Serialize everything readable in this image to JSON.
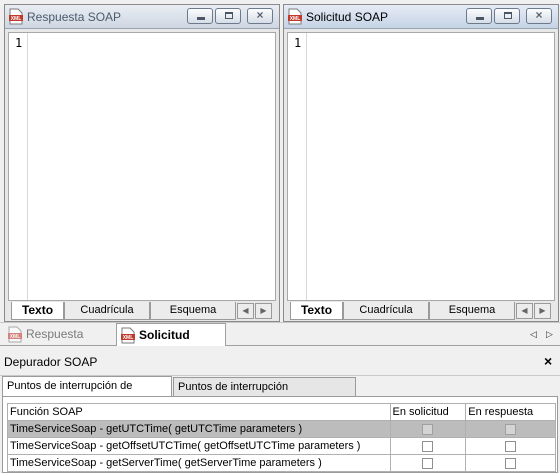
{
  "windows": [
    {
      "title": "Respuesta SOAP",
      "line_number": "1",
      "view_tabs": [
        "Texto",
        "Cuadrícula",
        "Esquema"
      ],
      "active_view": "Texto"
    },
    {
      "title": "Solicitud SOAP",
      "line_number": "1",
      "view_tabs": [
        "Texto",
        "Cuadrícula",
        "Esquema"
      ],
      "active_view": "Texto"
    }
  ],
  "file_icon_label": "XML",
  "window_controls": {
    "minimize": "minimize-icon",
    "maximize": "maximize-icon",
    "close": "×"
  },
  "document_tabs": [
    {
      "label": "Respuesta SOAP",
      "active": false
    },
    {
      "label": "Solicitud SOAP",
      "active": true
    }
  ],
  "debugger": {
    "title": "Depurador SOAP",
    "close_glyph": "×",
    "tabs": [
      "Puntos de interrupción de función",
      "Puntos de interrupción condicionales"
    ],
    "columns": [
      "Función SOAP",
      "En solicitud",
      "En respuesta"
    ],
    "rows": [
      {
        "function": "TimeServiceSoap - getUTCTime( getUTCTime parameters )",
        "on_request": false,
        "on_response": false,
        "selected": true
      },
      {
        "function": "TimeServiceSoap - getOffsetUTCTime( getOffsetUTCTime parameters )",
        "on_request": false,
        "on_response": false,
        "selected": false
      },
      {
        "function": "TimeServiceSoap - getServerTime( getServerTime parameters )",
        "on_request": false,
        "on_response": false,
        "selected": false
      }
    ]
  },
  "colors": {
    "accent_file_icon": "#c0392b",
    "selected_row": "#bcbcbc"
  }
}
